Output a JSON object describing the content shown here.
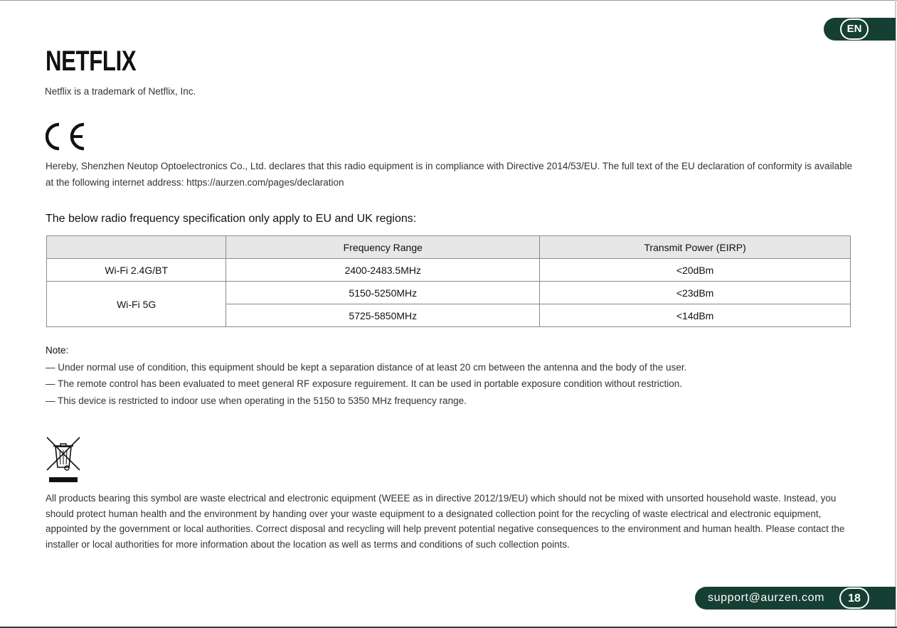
{
  "language_badge": "EN",
  "brand": {
    "logo_text": "NETFLIX",
    "trademark": "Netflix is a trademark of Netflix, Inc."
  },
  "ce": {
    "mark_text": "CE",
    "declaration": "Hereby, Shenzhen Neutop Optoelectronics Co., Ltd. declares that this radio equipment is in compliance with Directive 2014/53/EU. The full text of the EU declaration of conformity is available at the following internet address: https://aurzen.com/pages/declaration"
  },
  "rf_spec": {
    "heading": "The below radio frequency specification only apply to EU and UK regions:",
    "columns": [
      "",
      "Frequency Range",
      "Transmit Power (EIRP)"
    ],
    "rows": [
      {
        "band": "Wi-Fi 2.4G/BT",
        "frequency": "2400-2483.5MHz",
        "power": "<20dBm"
      },
      {
        "band": "Wi-Fi 5G",
        "frequency": "5150-5250MHz",
        "power": "<23dBm"
      },
      {
        "band": "",
        "frequency": "5725-5850MHz",
        "power": "<14dBm"
      }
    ]
  },
  "notes": {
    "title": "Note:",
    "items": [
      "— Under normal use of condition, this equipment should be kept a separation distance of at least 20 cm between the antenna and the body of the user.",
      "— The remote control has been evaluated to meet general RF exposure reguirement. It can be used in portable exposure condition without restriction.",
      "— This device is restricted to indoor use when operating in the 5150 to 5350 MHz frequency range."
    ]
  },
  "weee": {
    "icon": "crossed-out-wheelie-bin-icon",
    "text": "All products bearing this symbol are waste electrical and electronic equipment (WEEE as in directive 2012/19/EU) which should not be mixed with unsorted household waste. Instead, you should protect human health and the environment by handing over your waste equipment to a designated collection point for the recycling of waste electrical and electronic equipment, appointed by the government or local authorities. Correct disposal and recycling will help prevent potential negative consequences to the environment and human health. Please contact the installer or local authorities for more information about the location as well as terms and conditions of such collection points."
  },
  "footer": {
    "email": "support@aurzen.com",
    "page_number": "18"
  },
  "colors": {
    "accent": "#163f33",
    "table_header": "#e7e7e7"
  }
}
